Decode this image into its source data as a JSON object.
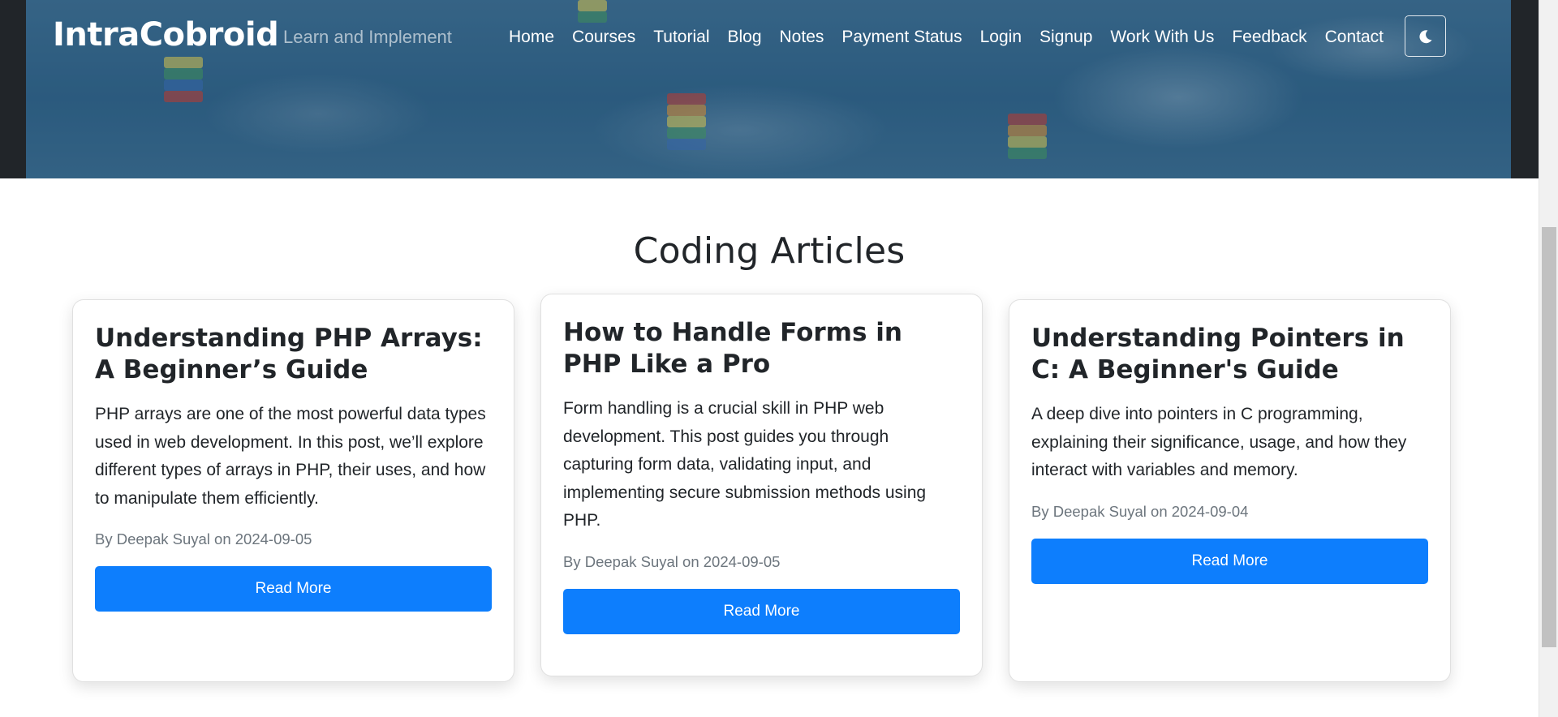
{
  "nav": {
    "brand": "IntraCobroid",
    "tagline": "Learn and Implement",
    "items": [
      {
        "label": "Home"
      },
      {
        "label": "Courses"
      },
      {
        "label": "Tutorial"
      },
      {
        "label": "Blog"
      },
      {
        "label": "Notes"
      },
      {
        "label": "Payment Status"
      },
      {
        "label": "Login"
      },
      {
        "label": "Signup"
      },
      {
        "label": "Work With Us"
      },
      {
        "label": "Feedback"
      },
      {
        "label": "Contact"
      }
    ],
    "theme_icon": "moon-icon"
  },
  "section": {
    "title": "Coding Articles"
  },
  "articles": [
    {
      "title": "Understanding PHP Arrays: A Beginner’s Guide",
      "description": "PHP arrays are one of the most powerful data types used in web development. In this post, we’ll explore different types of arrays in PHP, their uses, and how to manipulate them efficiently.",
      "meta": "By Deepak Suyal on 2024-09-05",
      "button": "Read More"
    },
    {
      "title": "How to Handle Forms in PHP Like a Pro",
      "description": "Form handling is a crucial skill in PHP web development. This post guides you through capturing form data, validating input, and implementing secure submission methods using PHP.",
      "meta": "By Deepak Suyal on 2024-09-05",
      "button": "Read More"
    },
    {
      "title": "Understanding Pointers in C: A Beginner's Guide",
      "description": "A deep dive into pointers in C programming, explaining their significance, usage, and how they interact with variables and memory.",
      "meta": "By Deepak Suyal on 2024-09-04",
      "button": "Read More"
    }
  ],
  "colors": {
    "primary_button": "#0d7efd",
    "nav_background": "#212529",
    "meta_text": "#6c757d"
  }
}
